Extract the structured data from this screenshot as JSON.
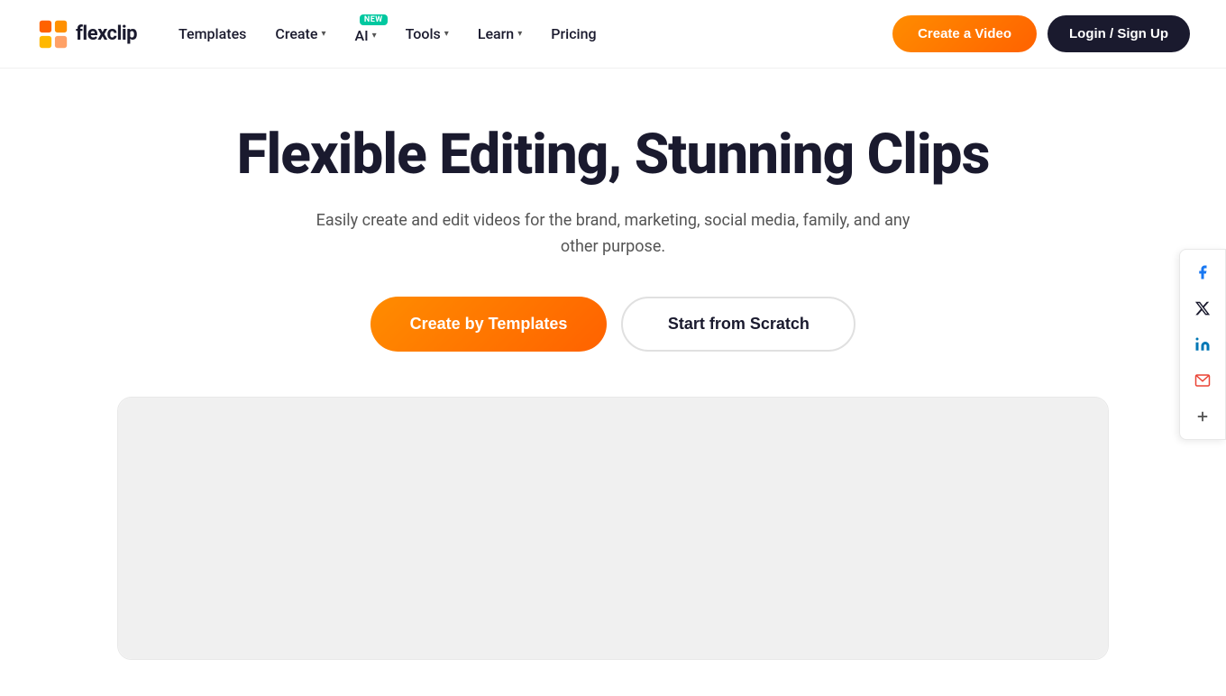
{
  "brand": {
    "name": "flexclip",
    "logo_text": "flexclip"
  },
  "nav": {
    "templates_label": "Templates",
    "create_label": "Create",
    "ai_label": "AI",
    "ai_badge": "NEW",
    "tools_label": "Tools",
    "learn_label": "Learn",
    "pricing_label": "Pricing",
    "create_video_label": "Create a Video",
    "login_label": "Login / Sign Up"
  },
  "hero": {
    "title": "Flexible Editing, Stunning Clips",
    "subtitle": "Easily create and edit videos for the brand, marketing, social media, family, and any other purpose.",
    "cta_templates": "Create by Templates",
    "cta_scratch": "Start from Scratch"
  },
  "social": {
    "facebook": "f",
    "twitter": "𝕏",
    "linkedin": "in",
    "email": "✉",
    "plus": "+"
  }
}
